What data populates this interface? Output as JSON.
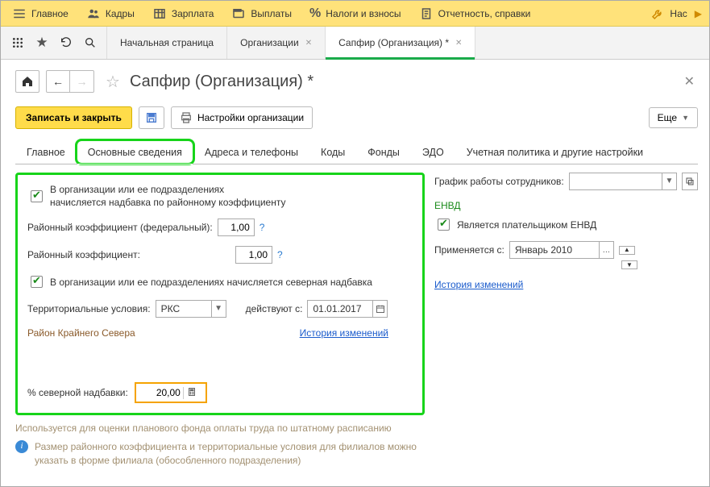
{
  "topmenu": {
    "main": "Главное",
    "staff": "Кадры",
    "salary": "Зарплата",
    "payments": "Выплаты",
    "taxes": "Налоги и взносы",
    "reports": "Отчетность, справки",
    "last_cut": "Нас"
  },
  "tabs": {
    "home": "Начальная страница",
    "org": "Организации",
    "active": "Сапфир (Организация) *"
  },
  "header": {
    "title": "Сапфир (Организация) *"
  },
  "toolbar": {
    "save_close": "Записать и закрыть",
    "settings": "Настройки организации",
    "more": "Еще"
  },
  "inner_tabs": {
    "t1": "Главное",
    "t2": "Основные сведения",
    "t3": "Адреса и телефоны",
    "t4": "Коды",
    "t5": "Фонды",
    "t6": "ЭДО",
    "t7": "Учетная политика и другие настройки"
  },
  "left": {
    "chk1_label": "В организации или ее подразделениях\nначисляется надбавка по районному коэффициенту",
    "rk_fed_label": "Районный коэффициент (федеральный):",
    "rk_fed_value": "1,00",
    "rk_label": "Районный коэффициент:",
    "rk_value": "1,00",
    "chk2_label": "В организации или ее подразделениях начисляется северная надбавка",
    "terr_label": "Территориальные условия:",
    "terr_value": "РКС",
    "since_label": "действуют с:",
    "since_value": "01.01.2017",
    "region_note": "Район Крайнего Севера",
    "history": "История изменений",
    "pct_label": "% северной надбавки:",
    "pct_value": "20,00",
    "gray_note": "Используется для оценки планового фонда оплаты труда по штатному расписанию",
    "info_note": "Размер районного коэффициента и территориальные условия для филиалов можно указать в форме филиала (обособленного подразделения)",
    "help_q": "?"
  },
  "right": {
    "schedule_label": "График работы сотрудников:",
    "envd_head": "ЕНВД",
    "envd_chk": "Является плательщиком ЕНВД",
    "since_label": "Применяется с:",
    "since_value": "Январь 2010",
    "history": "История изменений"
  }
}
